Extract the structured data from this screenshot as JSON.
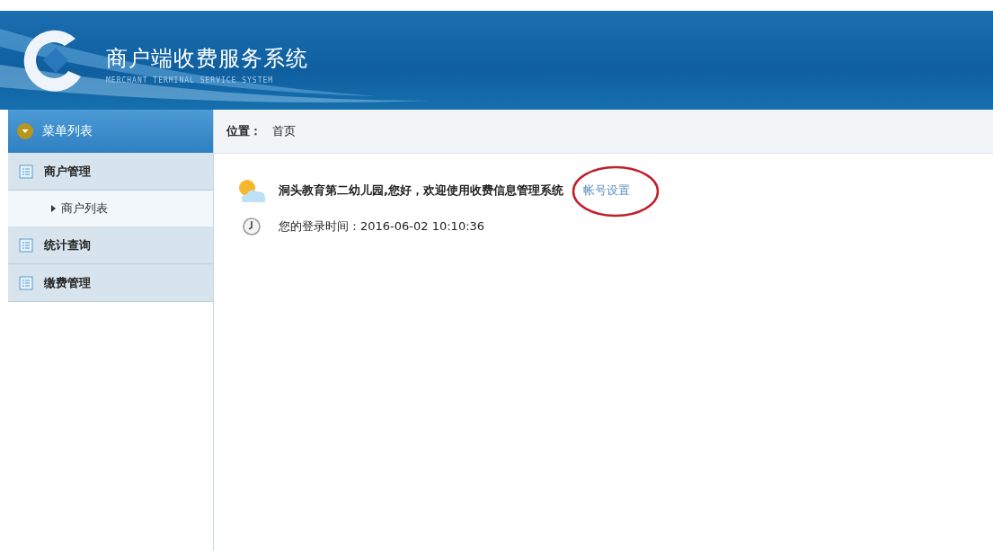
{
  "header": {
    "title": "商户端收费服务系统",
    "subtitle": "MERCHANT TERMINAL SERVICE SYSTEM"
  },
  "sidebar": {
    "title": "菜单列表",
    "items": [
      {
        "label": "商户管理",
        "children": [
          {
            "label": "商户列表"
          }
        ]
      },
      {
        "label": "统计查询"
      },
      {
        "label": "缴费管理"
      }
    ]
  },
  "breadcrumb": {
    "label": "位置：",
    "current": "首页"
  },
  "welcome": {
    "message": "洞头教育第二幼儿园,您好，欢迎使用收费信息管理系统",
    "link": "帐号设置",
    "login_time": "您的登录时间：2016-06-02 10:10:36"
  }
}
